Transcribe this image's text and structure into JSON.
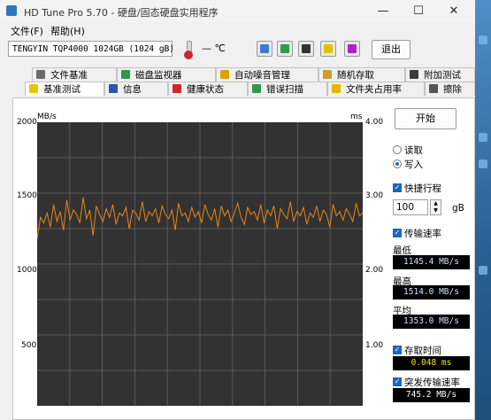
{
  "window": {
    "title": "HD Tune Pro 5.70 - 硬盘/固态硬盘实用程序",
    "minimize": "—",
    "maximize": "☐",
    "close": "✕"
  },
  "menu": {
    "file": "文件(F)",
    "help": "帮助(H)"
  },
  "toolbar": {
    "drive": "TENGYIN TQP4000 1024GB (1024 gB)",
    "temperature": "— ℃",
    "exit": "退出",
    "icons": [
      "copy-icon",
      "copy-screen-icon",
      "camera-icon",
      "health-icon",
      "download-icon"
    ]
  },
  "tabs": {
    "row1": [
      "文件基准",
      "磁盘监视器",
      "自动噪音管理",
      "随机存取",
      "附加测试"
    ],
    "row2": [
      "基准测试",
      "信息",
      "健康状态",
      "错误扫描",
      "文件夹占用率",
      "擦除"
    ],
    "active": "基准测试"
  },
  "chart": {
    "left_unit": "MB/s",
    "right_unit": "ms",
    "left_ticks": [
      "2000",
      "1500",
      "1000",
      "500"
    ],
    "right_ticks": [
      "4.00",
      "3.00",
      "2.00",
      "1.00"
    ],
    "line_color": "#e8861a",
    "background": "#323232"
  },
  "chart_data": {
    "type": "line",
    "ylim": [
      0,
      2000
    ],
    "y2lim": [
      0,
      4.0
    ],
    "grid": true,
    "series": [
      {
        "values": [
          1180,
          1330,
          1290,
          1360,
          1260,
          1420,
          1300,
          1370,
          1240,
          1450,
          1310,
          1380,
          1350,
          1290,
          1470,
          1320,
          1380,
          1200,
          1410,
          1350,
          1300,
          1390,
          1330,
          1420,
          1280,
          1360,
          1340,
          1400,
          1250,
          1380,
          1360,
          1310,
          1440,
          1300,
          1370,
          1340,
          1390,
          1290,
          1410,
          1350,
          1320,
          1380,
          1240,
          1430,
          1340,
          1360,
          1300,
          1400,
          1330,
          1370,
          1290,
          1420,
          1350,
          1310,
          1390,
          1260,
          1410,
          1340,
          1380,
          1300,
          1360,
          1430,
          1330,
          1280,
          1400,
          1350,
          1370,
          1310,
          1420,
          1290,
          1380,
          1340,
          1410,
          1250,
          1390,
          1350,
          1320,
          1440,
          1300,
          1370,
          1340,
          1400,
          1280,
          1360,
          1330,
          1410,
          1300,
          1380,
          1350,
          1260,
          1420,
          1340,
          1370,
          1310,
          1390,
          1350,
          1300,
          1430,
          1340,
          1360
        ]
      }
    ]
  },
  "controls": {
    "start": "开始",
    "read": "读取",
    "write": "写入",
    "mode": "write",
    "short_stroke": "快捷行程",
    "short_stroke_value": "100",
    "short_stroke_unit": "gB",
    "transfer_rate": "传输速率",
    "min_label": "最低",
    "min_value": "1145.4 MB/s",
    "max_label": "最高",
    "max_value": "1514.0 MB/s",
    "avg_label": "平均",
    "avg_value": "1353.0 MB/s",
    "access_time": "存取时间",
    "access_value": "0.048 ms",
    "burst_rate": "突发传输速率",
    "burst_value": "745.2 MB/s"
  }
}
